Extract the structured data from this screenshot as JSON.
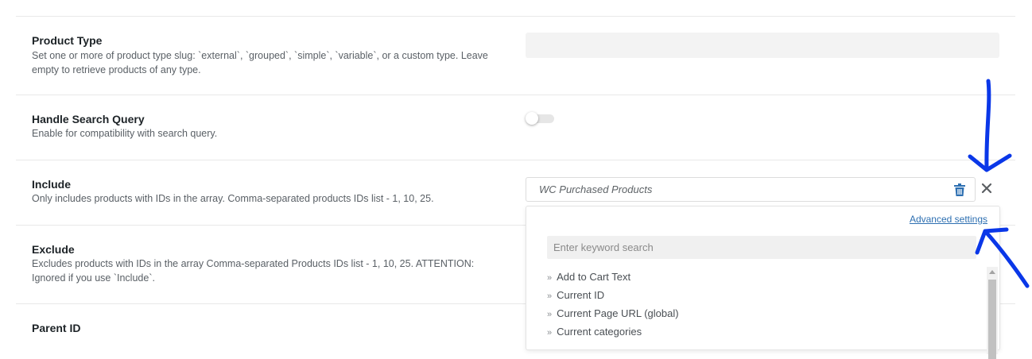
{
  "settings": [
    {
      "title": "Product Type",
      "description": "Set one or more of product type slug: `external`, `grouped`, `simple`, `variable`, or a custom type. Leave empty to retrieve products of any type."
    },
    {
      "title": "Handle Search Query",
      "description": "Enable for compatibility with search query.",
      "toggle_on": false
    },
    {
      "title": "Include",
      "description": "Only includes products with IDs in the array. Comma-separated products IDs list - 1, 10, 25.",
      "dynamic_value": "WC Purchased Products"
    },
    {
      "title": "Exclude",
      "description": "Excludes products with IDs in the array Comma-separated Products IDs list - 1, 10, 25. ATTENTION: Ignored if you use `Include`."
    },
    {
      "title": "Parent ID"
    }
  ],
  "dropdown": {
    "advanced_link": "Advanced settings",
    "search_placeholder": "Enter keyword search",
    "chevron": "»",
    "items": [
      "Add to Cart Text",
      "Current ID",
      "Current Page URL (global)",
      "Current categories"
    ]
  },
  "icons": {
    "trash": "trash-icon",
    "close": "close-icon",
    "trash_color": "#2d6fb1",
    "annotation_color": "#0a37e8"
  }
}
